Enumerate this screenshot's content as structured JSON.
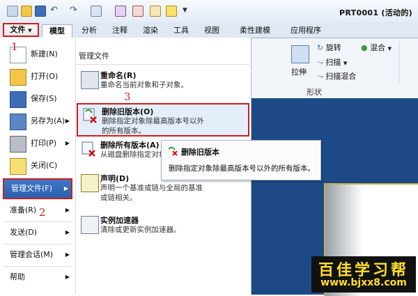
{
  "quick_access": {
    "icons": [
      "new-icon",
      "open-icon",
      "save-icon",
      "undo-icon",
      "redo-icon",
      "window-icon",
      "regenerate-icon",
      "appearance-icon",
      "edit-icon",
      "folder-icon",
      "customize-icon"
    ]
  },
  "window_title": "PRT0001 (活动的)",
  "tabs": {
    "file": "文件",
    "model": "模型",
    "analysis": "分析",
    "annotate": "注释",
    "render": "渲染",
    "tools": "工具",
    "view": "视图",
    "flexible": "柔性建模",
    "apps": "应用程序"
  },
  "ribbon": {
    "revolve": "旋转",
    "sweep": "扫描",
    "swept_blend": "扫描混合",
    "blend": "混合",
    "extrude": "拉伸",
    "group_label": "形状"
  },
  "file_menu": {
    "items": [
      {
        "label": "新建(N)"
      },
      {
        "label": "打开(O)"
      },
      {
        "label": "保存(S)"
      },
      {
        "label": "另存为(A)"
      },
      {
        "label": "打印(P)"
      },
      {
        "label": "关闭(C)"
      },
      {
        "label": "管理文件(F)"
      },
      {
        "label": "准备(R)"
      },
      {
        "label": "发送(D)"
      },
      {
        "label": "管理会话(M)"
      },
      {
        "label": "帮助"
      }
    ]
  },
  "manage_files": {
    "heading": "管理文件",
    "items": [
      {
        "title": "重命名(R)",
        "desc": "重命名当前对象和子对象。"
      },
      {
        "title": "删除旧版本(O)",
        "desc": "删除指定对象除最高版本号以外的所有版本。"
      },
      {
        "title": "删除所有版本(A)",
        "desc": "从磁盘删除指定对象"
      },
      {
        "title": "声明(D)",
        "desc": "声明一个基准或链与全局的基准或链相关。"
      },
      {
        "title": "实例加速器",
        "desc": "清除或更新实例加速器。"
      }
    ]
  },
  "tooltip": {
    "title": "删除旧版本",
    "desc": "删除指定对象除最高版本号以外的所有版本。"
  },
  "steps": [
    "1",
    "2",
    "3"
  ],
  "logo": {
    "line1": "百佳学习帮",
    "line2": "www.bjxx8.com"
  },
  "colors": {
    "highlight_border": "#d21b1b",
    "selected_bg": "#2c5fae",
    "graphics_bg": "#1d4a86"
  }
}
